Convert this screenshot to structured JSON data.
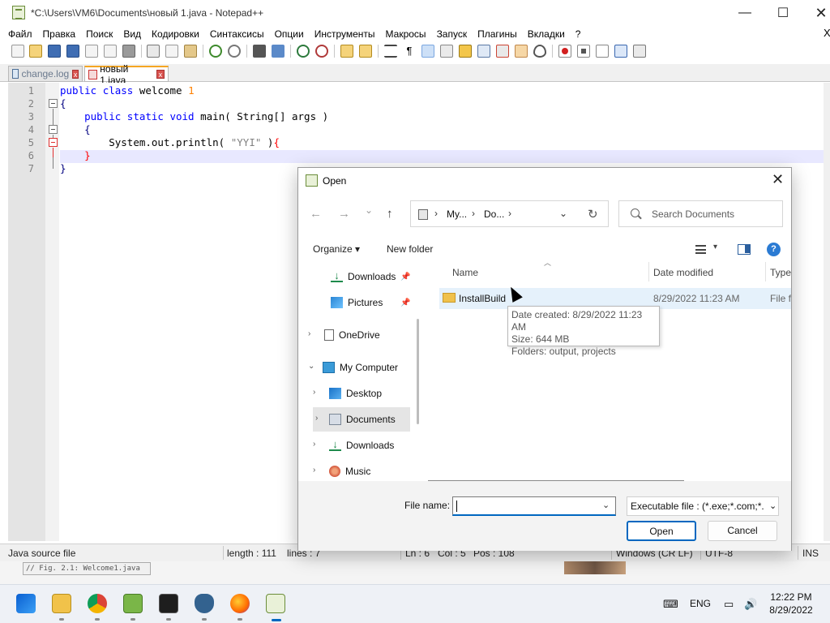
{
  "notepad": {
    "title": "*C:\\Users\\VM6\\Documents\\новый 1.java - Notepad++",
    "menu": [
      "Файл",
      "Правка",
      "Поиск",
      "Вид",
      "Кодировки",
      "Синтаксисы",
      "Опции",
      "Инструменты",
      "Макросы",
      "Запуск",
      "Плагины",
      "Вкладки",
      "?"
    ],
    "menu_close": "X",
    "tabs": [
      {
        "label": "change.log",
        "close": "x"
      },
      {
        "label": "новый 1.java",
        "close": "x"
      }
    ],
    "line_numbers": [
      "1",
      "2",
      "3",
      "4",
      "5",
      "6",
      "7"
    ],
    "code": {
      "l1_kw1": "public",
      "l1_kw2": "class",
      "l1_name": "welcome",
      "l1_num": "1",
      "l2": "{",
      "l3_kw1": "public",
      "l3_kw2": "static",
      "l3_kw3": "void",
      "l3_rest": "main( String[] args )",
      "l4": "{",
      "l5_pre": "System.out.println(",
      "l5_str": "\"YYI\"",
      "l5_post": ")",
      "l5_brace": "{",
      "l6": "}",
      "l7": "}"
    },
    "status": {
      "type": "Java source file",
      "length": "length : 111",
      "lines": "lines : 7",
      "ln": "Ln : 6",
      "col": "Col : 5",
      "pos": "Pos : 108",
      "eol": "Windows (CR LF)",
      "encoding": "UTF-8",
      "mode": "INS"
    },
    "background_snippet": "// Fig. 2.1: Welcome1.java"
  },
  "dialog": {
    "title": "Open",
    "close": "✕",
    "nav": {
      "back": "←",
      "forward": "→",
      "recent": "⌄",
      "up": "↑"
    },
    "address": {
      "crumb1": "My...",
      "crumb2": "Do...",
      "sep": "›",
      "dropdown": "⌄",
      "refresh": "↻"
    },
    "search_placeholder": "Search Documents",
    "organize": "Organize ▾",
    "new_folder": "New folder",
    "view_dropdown": "▾",
    "help": "?",
    "nav_items": [
      {
        "label": "Downloads",
        "icon": "download-icon"
      },
      {
        "label": "Pictures",
        "icon": "pictures-icon"
      },
      {
        "label": "OneDrive",
        "icon": "cloud-icon"
      },
      {
        "label": "My Computer",
        "icon": "computer-icon"
      },
      {
        "label": "Desktop",
        "icon": "desktop-icon"
      },
      {
        "label": "Documents",
        "icon": "documents-icon"
      },
      {
        "label": "Downloads",
        "icon": "download-icon"
      },
      {
        "label": "Music",
        "icon": "music-icon"
      }
    ],
    "columns": {
      "name": "Name",
      "date": "Date modified",
      "type": "Type"
    },
    "files": [
      {
        "name": "InstallBuild",
        "date": "8/29/2022 11:23 AM",
        "type": "File folder"
      }
    ],
    "tooltip": {
      "created": "Date created: 8/29/2022 11:23 AM",
      "size": "Size: 644 MB",
      "folders": "Folders: output, projects"
    },
    "filename_label": "File name:",
    "filename_value": "",
    "filter": "Executable file : (*.exe;*.com;*.",
    "open": "Open",
    "cancel": "Cancel"
  },
  "taskbar": {
    "lang": "ENG",
    "time": "12:22 PM",
    "date": "8/29/2022"
  }
}
